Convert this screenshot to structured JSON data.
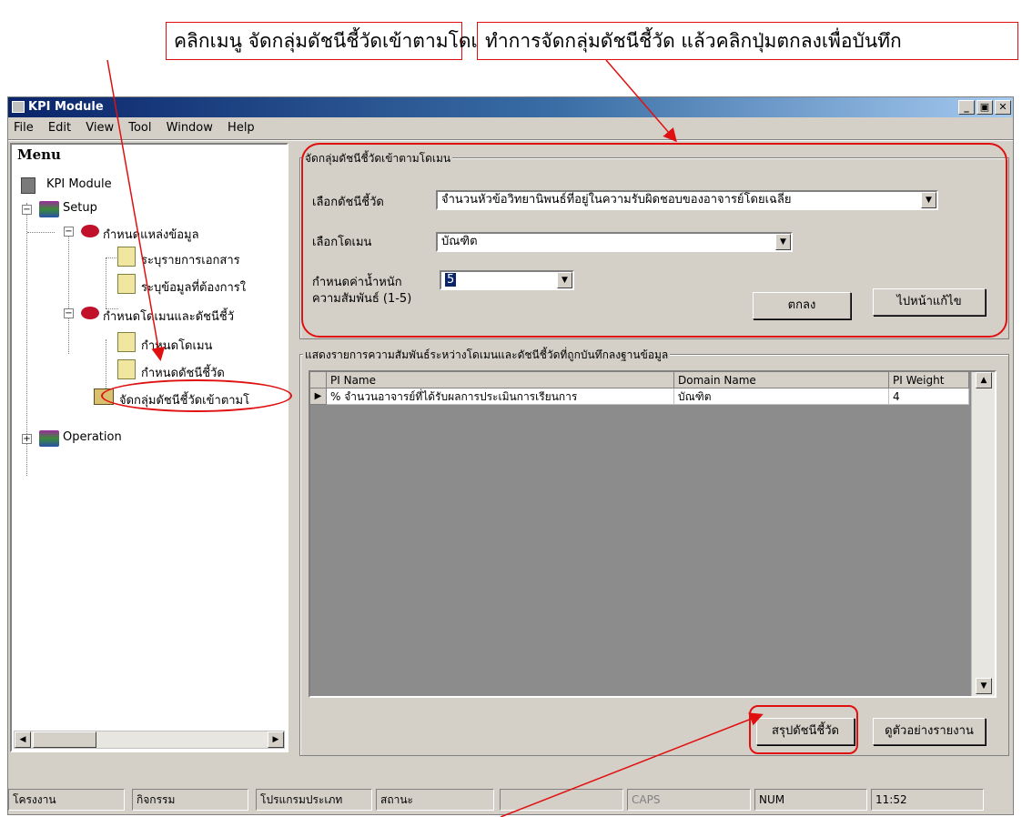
{
  "annotations": {
    "callout_left": "คลิกเมนู จัดกลุ่มดัชนีชี้วัดเข้าตามโดเมน",
    "callout_right": "ทำการจัดกลุ่มดัชนีชี้วัด แล้วคลิกปุ่มตกลงเพื่อบันทึก"
  },
  "window": {
    "title": "KPI Module",
    "controls": [
      "_",
      "▣",
      "✕"
    ]
  },
  "menubar": [
    "File",
    "Edit",
    "View",
    "Tool",
    "Window",
    "Help"
  ],
  "tree": {
    "title": "Menu",
    "root": "KPI Module",
    "setup": "Setup",
    "data_source": "กำหนดแหล่งข้อมูล",
    "doc_list": "ระบุรายการเอกสาร",
    "data_req": "ระบุข้อมูลที่ต้องการใ",
    "domain_pi": "กำหนดโดเมนและดัชนีชี้วั",
    "set_domain": "กำหนดโดเมน",
    "set_pi": "กำหนดดัชนีชี้วัด",
    "group_pi": "จัดกลุ่มดัชนีชี้วัดเข้าตามโ",
    "operation": "Operation"
  },
  "form": {
    "group_title": "จัดกลุ่มดัชนีชี้วัดเข้าตามโดเมน",
    "pi_label": "เลือกดัชนีชี้วัด",
    "pi_value": "จำนวนหัวข้อวิทยานิพนธ์ที่อยู่ในความรับผิดชอบของอาจารย์โดยเฉลี่ย",
    "domain_label": "เลือกโดเมน",
    "domain_value": "บัณฑิต",
    "weight_label_1": "กำหนดค่าน้ำหนัก",
    "weight_label_2": "ความสัมพันธ์ (1-5)",
    "weight_value": "5",
    "ok_button": "ตกลง",
    "edit_button": "ไปหน้าแก้ไข"
  },
  "list": {
    "group_title": "แสดงรายการความสัมพันธ์ระหว่างโดเมนและดัชนีชี้วัดที่ถูกบันทึกลงฐานข้อมูล",
    "columns": [
      "PI Name",
      "Domain Name",
      "PI Weight"
    ],
    "rows": [
      [
        "% จำนวนอาจารย์ที่ได้รับผลการประเมินการเรียนการ",
        "บัณฑิต",
        "4"
      ]
    ],
    "summary_button": "สรุปดัชนีชี้วัด",
    "report_button": "ดูตัวอย่างรายงาน"
  },
  "statusbar": [
    "โครงงาน",
    "กิจกรรม",
    "โปรแกรมประเภท",
    "สถานะ",
    "",
    "CAPS",
    "NUM",
    "11:52"
  ],
  "colors": {
    "annotation": "#e01010",
    "titlebar": "#0a246a",
    "face": "#d4d0c8"
  }
}
